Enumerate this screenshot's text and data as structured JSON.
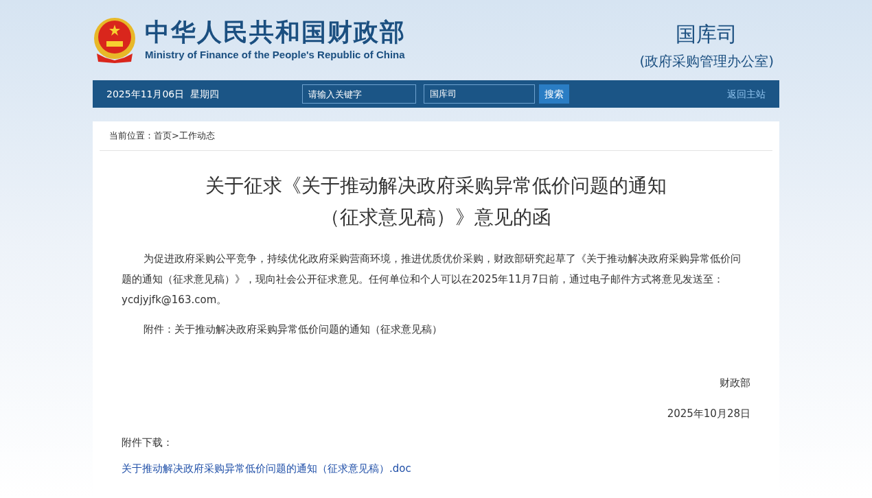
{
  "header": {
    "title": "中华人民共和国财政部",
    "subtitle": "Ministry of Finance of the People's Republic of China",
    "department": "国库司",
    "department_note": "(政府采购管理办公室)"
  },
  "nav": {
    "date": "2025年11月06日  星期四",
    "search": {
      "placeholder": "请输入关键字"
    },
    "scope": {
      "value": "国库司"
    },
    "search_button": "搜索",
    "home_link": "返回主站"
  },
  "breadcrumb": {
    "label": "当前位置：",
    "items": [
      "首页",
      ">",
      "工作动态"
    ]
  },
  "article": {
    "title_lines": [
      "关于征求《关于推动解决政府采购异常低价问题的通知",
      "（征求意见稿）》意见的函"
    ],
    "paragraphs": [
      "为促进政府采购公平竞争，持续优化政府采购营商环境，推进优质优价采购，财政部研究起草了《关于推动解决政府采购异常低价问题的通知（征求意见稿）》，现向社会公开征求意见。任何单位和个人可以在2025年11月7日前，通过电子邮件方式将意见发送至：ycdjyjfk@163.com。",
      "附件：关于推动解决政府采购异常低价问题的通知（征求意见稿）"
    ],
    "signature": "财政部",
    "date": "2025年10月28日",
    "attachments_label": "附件下载：",
    "attachments": [
      "关于推动解决政府采购异常低价问题的通知（征求意见稿）.doc"
    ]
  }
}
